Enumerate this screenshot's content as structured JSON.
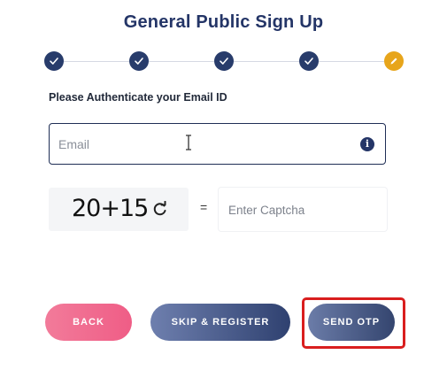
{
  "page": {
    "title": "General Public Sign Up"
  },
  "stepper": {
    "steps": [
      {
        "status": "completed",
        "icon": "check-icon"
      },
      {
        "status": "completed",
        "icon": "check-icon"
      },
      {
        "status": "completed",
        "icon": "check-icon"
      },
      {
        "status": "completed",
        "icon": "check-icon"
      },
      {
        "status": "current",
        "icon": "pencil-icon"
      }
    ],
    "colors": {
      "completed": "#283c6b",
      "current": "#e7a51b"
    }
  },
  "form": {
    "auth_label": "Please Authenticate your Email ID",
    "email": {
      "placeholder": "Email",
      "value": "",
      "info_icon": "info-icon"
    },
    "captcha": {
      "challenge": "20+15",
      "refresh_icon": "refresh-icon",
      "equals": "=",
      "input_placeholder": "Enter Captcha",
      "input_value": ""
    }
  },
  "buttons": {
    "back": "BACK",
    "skip_register": "SKIP & REGISTER",
    "send_otp": "SEND OTP"
  },
  "colors": {
    "back_button": "#ef5d86",
    "skip_button": "#2f4170",
    "send_button": "#34456f",
    "highlight": "#d91e1e"
  }
}
